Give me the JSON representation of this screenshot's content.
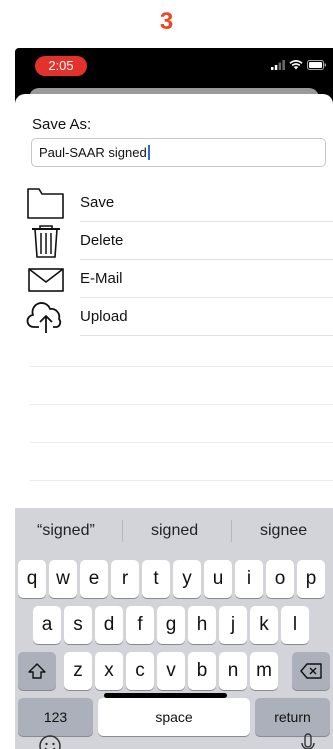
{
  "step_number": "3",
  "status_bar": {
    "time": "2:05"
  },
  "dialog": {
    "save_as_label": "Save As:",
    "filename_value": "Paul-SAAR signed"
  },
  "menu": {
    "items": [
      {
        "label": "Save",
        "icon": "folder-icon"
      },
      {
        "label": "Delete",
        "icon": "trash-icon"
      },
      {
        "label": "E-Mail",
        "icon": "envelope-icon"
      },
      {
        "label": "Upload",
        "icon": "cloud-upload-icon"
      }
    ]
  },
  "keyboard": {
    "suggestions": [
      "“signed”",
      "signed",
      "signee"
    ],
    "row1": [
      "q",
      "w",
      "e",
      "r",
      "t",
      "y",
      "u",
      "i",
      "o",
      "p"
    ],
    "row2": [
      "a",
      "s",
      "d",
      "f",
      "g",
      "h",
      "j",
      "k",
      "l"
    ],
    "row3": [
      "z",
      "x",
      "c",
      "v",
      "b",
      "n",
      "m"
    ],
    "numbers_key": "123",
    "space_key": "space",
    "return_key": "return"
  },
  "colors": {
    "step_number": "#f0441d",
    "time_pill": "#e3322b",
    "keyboard_bg": "#d2d4d9",
    "cursor": "#2f6bd8"
  }
}
